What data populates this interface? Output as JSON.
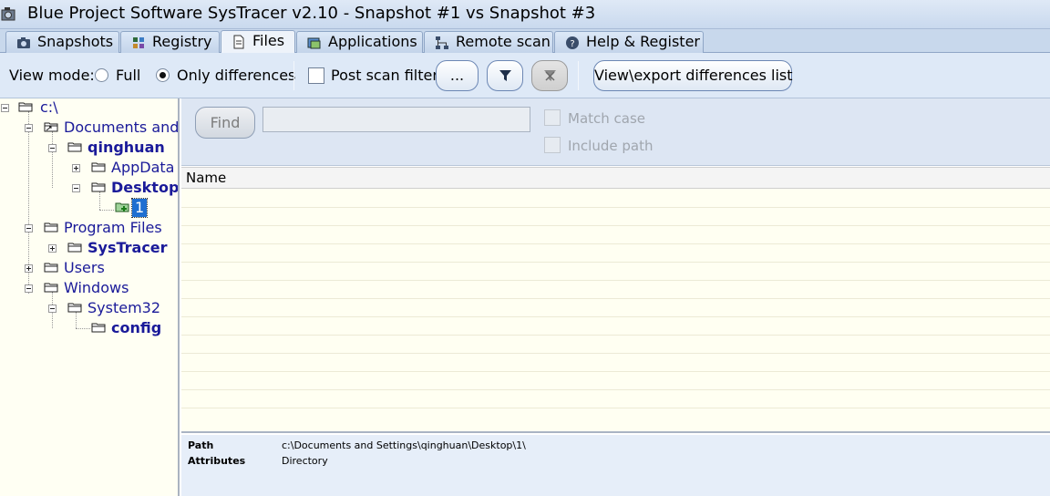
{
  "window": {
    "title": "Blue Project Software SysTracer v2.10 - Snapshot #1 vs Snapshot #3"
  },
  "tabs": [
    {
      "label": "Snapshots",
      "icon": "camera-icon"
    },
    {
      "label": "Registry",
      "icon": "registry-icon"
    },
    {
      "label": "Files",
      "icon": "file-icon",
      "active": true
    },
    {
      "label": "Applications",
      "icon": "applications-icon"
    },
    {
      "label": "Remote scan",
      "icon": "network-icon"
    },
    {
      "label": "Help & Register",
      "icon": "help-icon"
    }
  ],
  "toolbar": {
    "view_mode_label": "View mode:",
    "full_label": "Full",
    "only_differences_label": "Only differences",
    "selected_mode": "Only differences",
    "post_scan_filter_label": "Post scan filter",
    "post_scan_filter_checked": false,
    "more_button_label": "...",
    "filter_icon": "funnel-icon",
    "clear_filter_icon": "funnel-clear-icon",
    "export_button_label": "View\\export differences list"
  },
  "tree": {
    "root": "c:\\",
    "items": [
      {
        "label": "Documents and S",
        "bold": false
      },
      {
        "label": "qinghuan",
        "bold": true
      },
      {
        "label": "AppData",
        "bold": false
      },
      {
        "label": "Desktop",
        "bold": true
      },
      {
        "label": "1",
        "bold": false,
        "selected": true
      },
      {
        "label": "Program Files",
        "bold": false
      },
      {
        "label": "SysTracer",
        "bold": true
      },
      {
        "label": "Users",
        "bold": false
      },
      {
        "label": "Windows",
        "bold": false
      },
      {
        "label": "System32",
        "bold": false
      },
      {
        "label": "config",
        "bold": true
      }
    ]
  },
  "find": {
    "button_label": "Find",
    "input_value": "",
    "match_case_label": "Match case",
    "include_path_label": "Include path"
  },
  "list": {
    "column_name": "Name",
    "rows": []
  },
  "details": {
    "path_label": "Path",
    "path_value": "c:\\Documents and Settings\\qinghuan\\Desktop\\1\\",
    "attributes_label": "Attributes",
    "attributes_value": "Directory"
  }
}
